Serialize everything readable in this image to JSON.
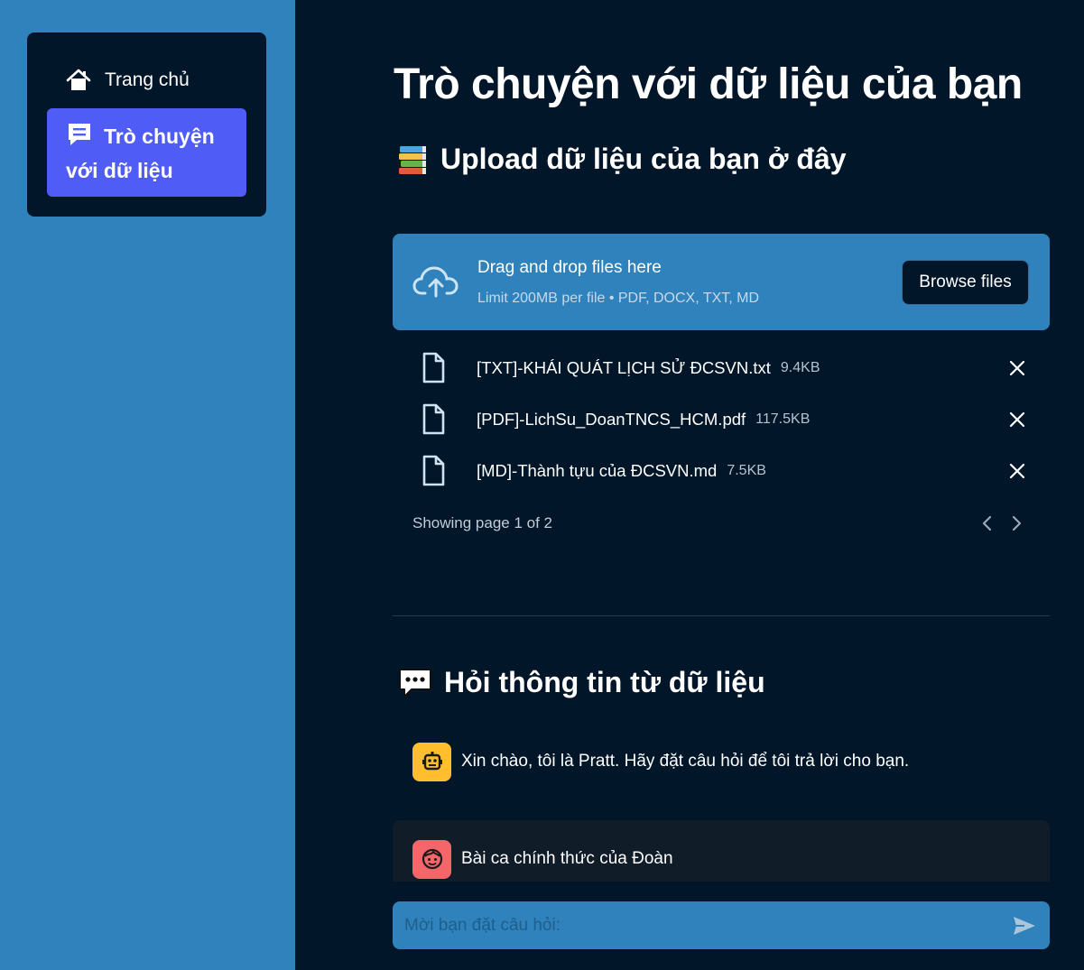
{
  "sidebar": {
    "items": [
      {
        "label": "Trang chủ",
        "icon": "home-icon"
      },
      {
        "label": "Trò chuyện với dữ liệu",
        "icon": "chat-bubble-icon",
        "active": true
      }
    ]
  },
  "main": {
    "title": "Trò chuyện với dữ liệu của bạn",
    "upload_section": {
      "title": "Upload dữ liệu của bạn ở đây",
      "icon": "books-emoji",
      "dropzone": {
        "main_text": "Drag and drop files here",
        "limit_text": "Limit 200MB per file • PDF, DOCX, TXT, MD",
        "browse_label": "Browse files",
        "icon": "cloud-upload-icon"
      },
      "files": [
        {
          "name": "[TXT]-KHÁI QUÁT LỊCH SỬ ĐCSVN.txt",
          "size": "9.4KB"
        },
        {
          "name": "[PDF]-LichSu_DoanTNCS_HCM.pdf",
          "size": "117.5KB"
        },
        {
          "name": "[MD]-Thành tựu của ĐCSVN.md",
          "size": "7.5KB"
        }
      ],
      "pagination": {
        "text": "Showing page 1 of 2",
        "current_page": 1,
        "total_pages": 2
      }
    },
    "chat_section": {
      "title": "Hỏi thông tin từ dữ liệu",
      "icon": "speech-balloon-emoji",
      "messages": [
        {
          "role": "assistant",
          "avatar": "robot-icon",
          "text": "Xin chào, tôi là Pratt. Hãy đặt câu hỏi để tôi trả lời cho bạn."
        },
        {
          "role": "user",
          "avatar": "smiley-face-icon",
          "text": "Bài ca chính thức của Đoàn"
        }
      ],
      "input": {
        "placeholder": "Mời bạn đặt câu hỏi:",
        "value": ""
      }
    }
  },
  "colors": {
    "sidebar_bg": "#2f82bc",
    "main_bg": "#021629",
    "active_nav": "#4f5cf5",
    "bot_avatar": "#ffbe2e",
    "user_avatar": "#f4666a"
  }
}
